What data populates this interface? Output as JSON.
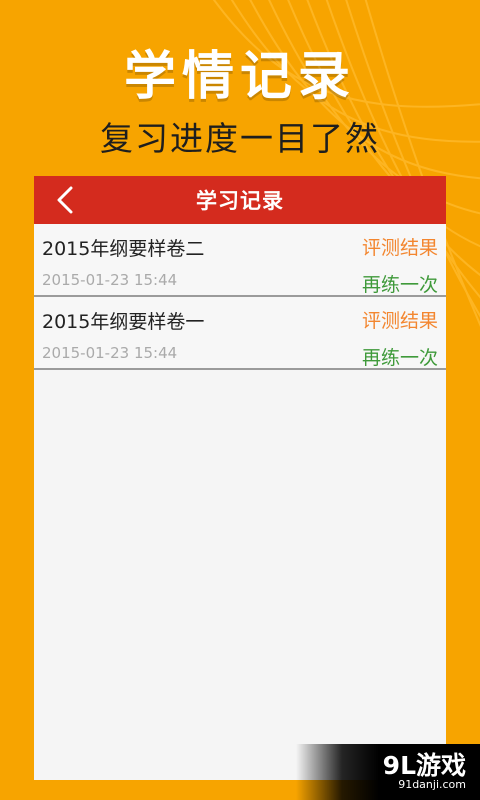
{
  "header": {
    "title": "学情记录",
    "subtitle": "复习进度一目了然"
  },
  "screen": {
    "title": "学习记录",
    "records": [
      {
        "name": "2015年纲要样卷二",
        "date": "2015-01-23 15:44",
        "result_label": "评测结果",
        "retry_label": "再练一次"
      },
      {
        "name": "2015年纲要样卷一",
        "date": "2015-01-23 15:44",
        "result_label": "评测结果",
        "retry_label": "再练一次"
      }
    ]
  },
  "watermark": {
    "brand": "9L游戏",
    "site": "91danji.com"
  },
  "colors": {
    "background": "#f7a400",
    "titlebar": "#d42b1e",
    "result": "#f3862f",
    "retry": "#3f9a3a"
  },
  "icons": {
    "back": "chevron-left-icon"
  }
}
